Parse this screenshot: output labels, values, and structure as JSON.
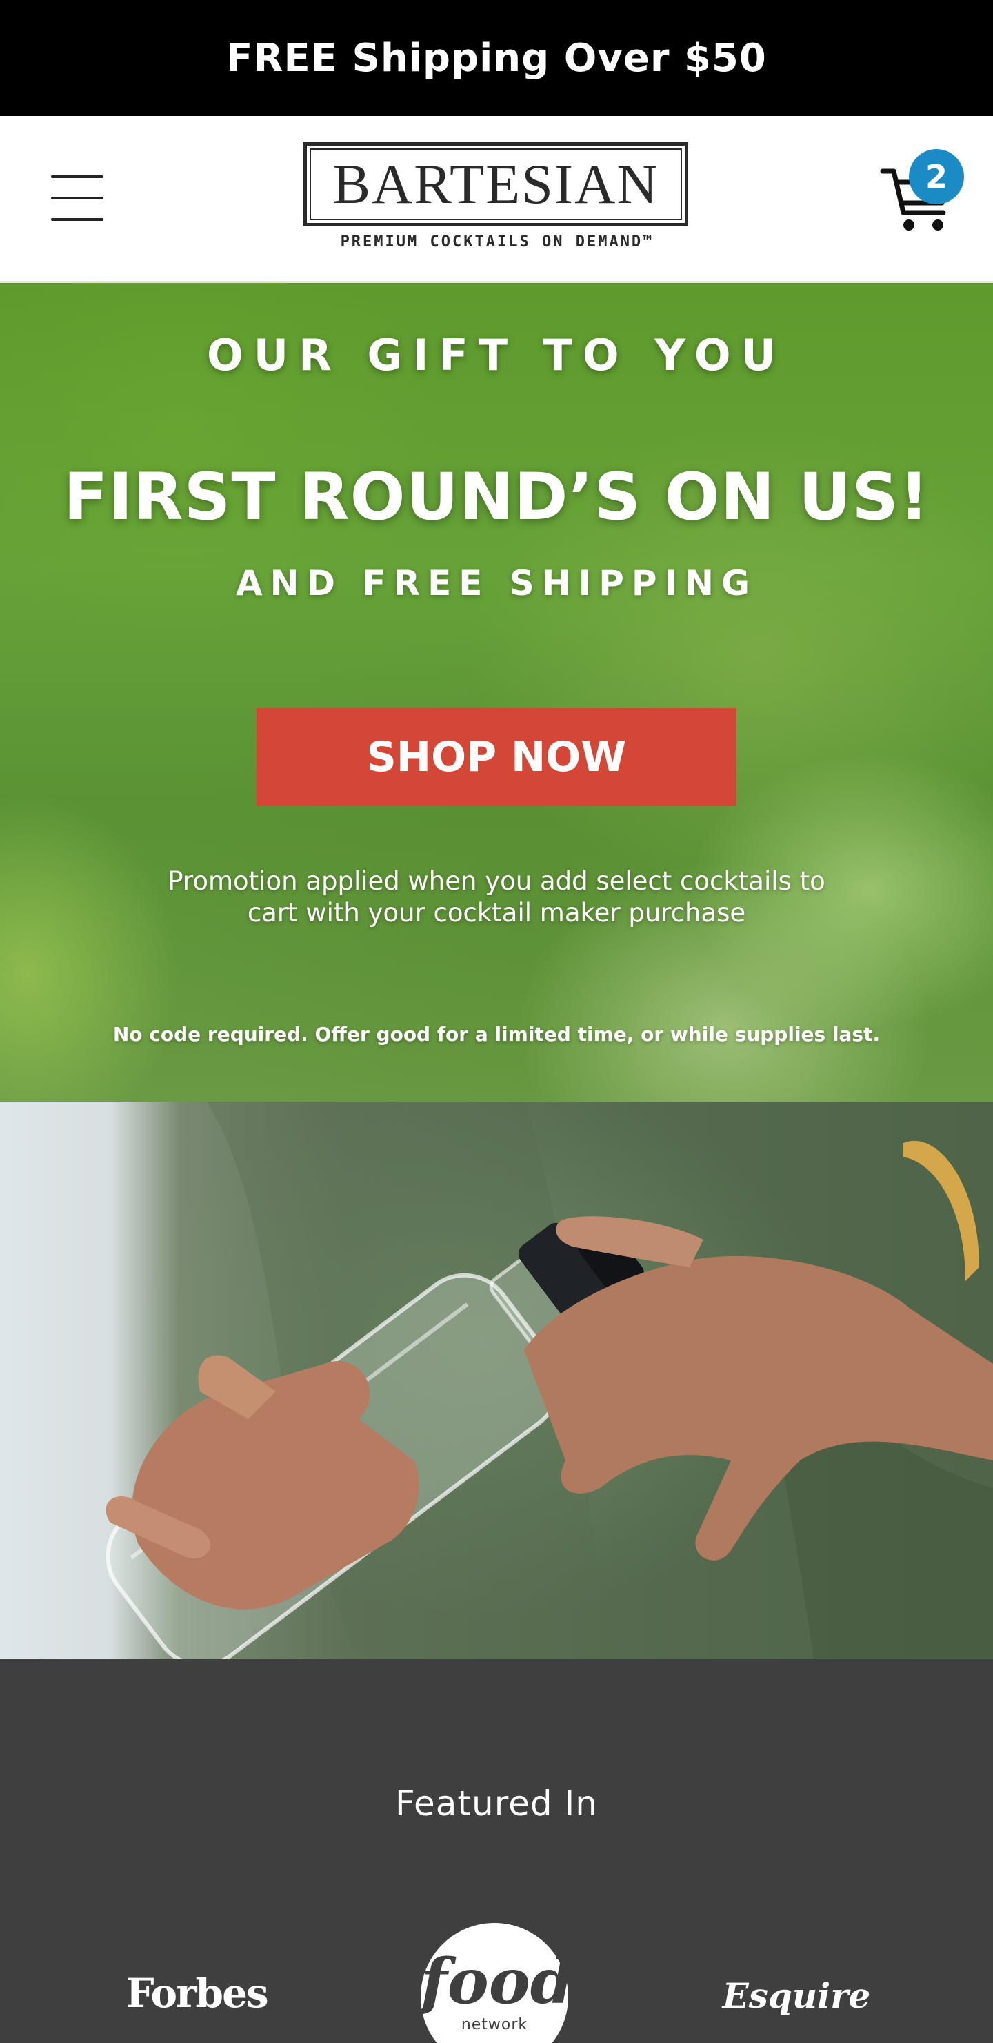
{
  "announcement": {
    "text": "FREE Shipping Over $50"
  },
  "header": {
    "menu_icon": "hamburger-menu-icon",
    "logo": {
      "name": "BARTESIAN",
      "tagline": "PREMIUM COCKTAILS ON DEMAND™"
    },
    "cart": {
      "icon": "shopping-cart-icon",
      "count": "2",
      "badge_color": "#1b8bc5"
    }
  },
  "hero": {
    "kicker": "OUR GIFT TO YOU",
    "title": "FIRST ROUND’S ON US!",
    "subtitle": "AND FREE SHIPPING",
    "cta_label": "SHOP NOW",
    "cta_color": "#d44636",
    "promo_line1": "Promotion applied when you add select cocktails to",
    "promo_line2": "cart with your cocktail maker purchase",
    "fineprint": "No code required. Offer good for a limited time, or while supplies last."
  },
  "featured": {
    "title": "Featured In",
    "logos": [
      "Forbes",
      "food",
      "network",
      "Esquire"
    ]
  },
  "colors": {
    "announcement_bg": "#000000",
    "featured_bg": "#3f3f3f"
  }
}
